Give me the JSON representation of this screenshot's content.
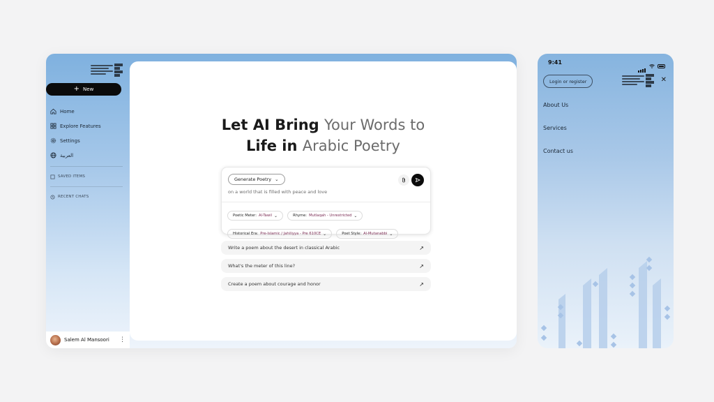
{
  "sidebar": {
    "new_label": "New",
    "nav": [
      {
        "label": "Home",
        "icon": "home-icon"
      },
      {
        "label": "Explore Features",
        "icon": "grid-icon"
      },
      {
        "label": "Settings",
        "icon": "gear-icon"
      },
      {
        "label": "العربية",
        "icon": "globe-icon"
      }
    ],
    "saved_items": "SAVED ITEMS",
    "recent_chats": "RECENT CHATS",
    "user_name": "Salem Al Mansoori"
  },
  "main": {
    "headline_line1_bold": "Let AI Bring ",
    "headline_line1_muted": "Your Words to",
    "headline_line2_bold": "Life in ",
    "headline_line2_muted": "Arabic Poetry",
    "mode_label": "Generate Poetry",
    "prompt": "on a world that is filled with peace and love",
    "filters": [
      {
        "label": "Poetic Meter:",
        "value": "Al-Tawil"
      },
      {
        "label": "Rhyme:",
        "value": "Mutlaqah - Unrestricted"
      },
      {
        "label": "Historical Era:",
        "value": "Pre-Islamic / Jahiliyya - Pre 610CE"
      },
      {
        "label": "Poet Style:",
        "value": "Al-Mutanabbi"
      }
    ],
    "suggestions": [
      "Write a poem about the desert in classical Arabic",
      "What's the meter of this line?",
      "Create a poem about courage and honor"
    ]
  },
  "mobile": {
    "time": "9:41",
    "login_label": "Login or register",
    "menu": [
      "About Us",
      "Services",
      "Contact us"
    ]
  }
}
